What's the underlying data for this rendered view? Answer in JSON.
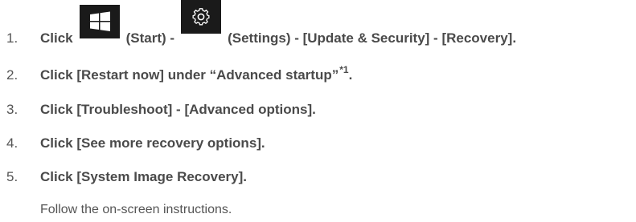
{
  "steps": [
    {
      "number": "1.",
      "click": "Click",
      "start_label": "(Start) -",
      "settings_label": "(Settings) - [Update & Security] - [Recovery]."
    },
    {
      "number": "2.",
      "text": "Click [Restart now] under “Advanced startup”",
      "superscript": "*1",
      "suffix": "."
    },
    {
      "number": "3.",
      "text": "Click [Troubleshoot] - [Advanced options]."
    },
    {
      "number": "4.",
      "text": "Click [See more recovery options]."
    },
    {
      "number": "5.",
      "text": "Click [System Image Recovery]."
    }
  ],
  "note": "Follow the on-screen instructions.",
  "icons": {
    "start": "windows-start-icon",
    "settings": "gear-icon"
  },
  "colors": {
    "text": "#4a4a4a",
    "icon_background": "#1a1a1a",
    "icon_foreground": "#ffffff"
  }
}
